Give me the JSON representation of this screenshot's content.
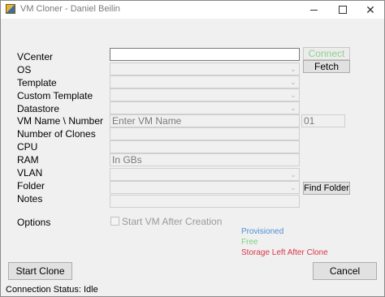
{
  "window": {
    "title": "VM Cloner - Daniel Beilin",
    "controls": {
      "minimize": "–",
      "close": "✕"
    }
  },
  "labels": {
    "vcenter": "VCenter",
    "os": "OS",
    "template": "Template",
    "custom_template": "Custom Template",
    "datastore": "Datastore",
    "vm_name_number": "VM Name \\ Number",
    "number_of_clones": "Number of Clones",
    "cpu": "CPU",
    "ram": "RAM",
    "vlan": "VLAN",
    "folder": "Folder",
    "notes": "Notes",
    "options": "Options"
  },
  "fields": {
    "vcenter_value": "",
    "vm_name_placeholder": "Enter VM Name",
    "vm_number_value": "01",
    "ram_placeholder": "In GBs"
  },
  "buttons": {
    "connect": "Connect",
    "fetch": "Fetch",
    "find_folder": "Find Folder",
    "start_clone": "Start Clone",
    "cancel": "Cancel"
  },
  "options": {
    "start_vm_after_creation": "Start VM After Creation"
  },
  "legend": {
    "provisioned": "Provisioned",
    "free": "Free",
    "storage_left": "Storage Left After Clone"
  },
  "status": {
    "label": "Connection Status:",
    "value": "Idle"
  },
  "colors": {
    "provisioned": "#4f8fd6",
    "free": "#7ed17e",
    "storage_left": "#d8364a",
    "connect_text": "#8fd18f"
  },
  "icons": {
    "combo_arrow": "chevron-down-icon",
    "app": "app-icon"
  }
}
